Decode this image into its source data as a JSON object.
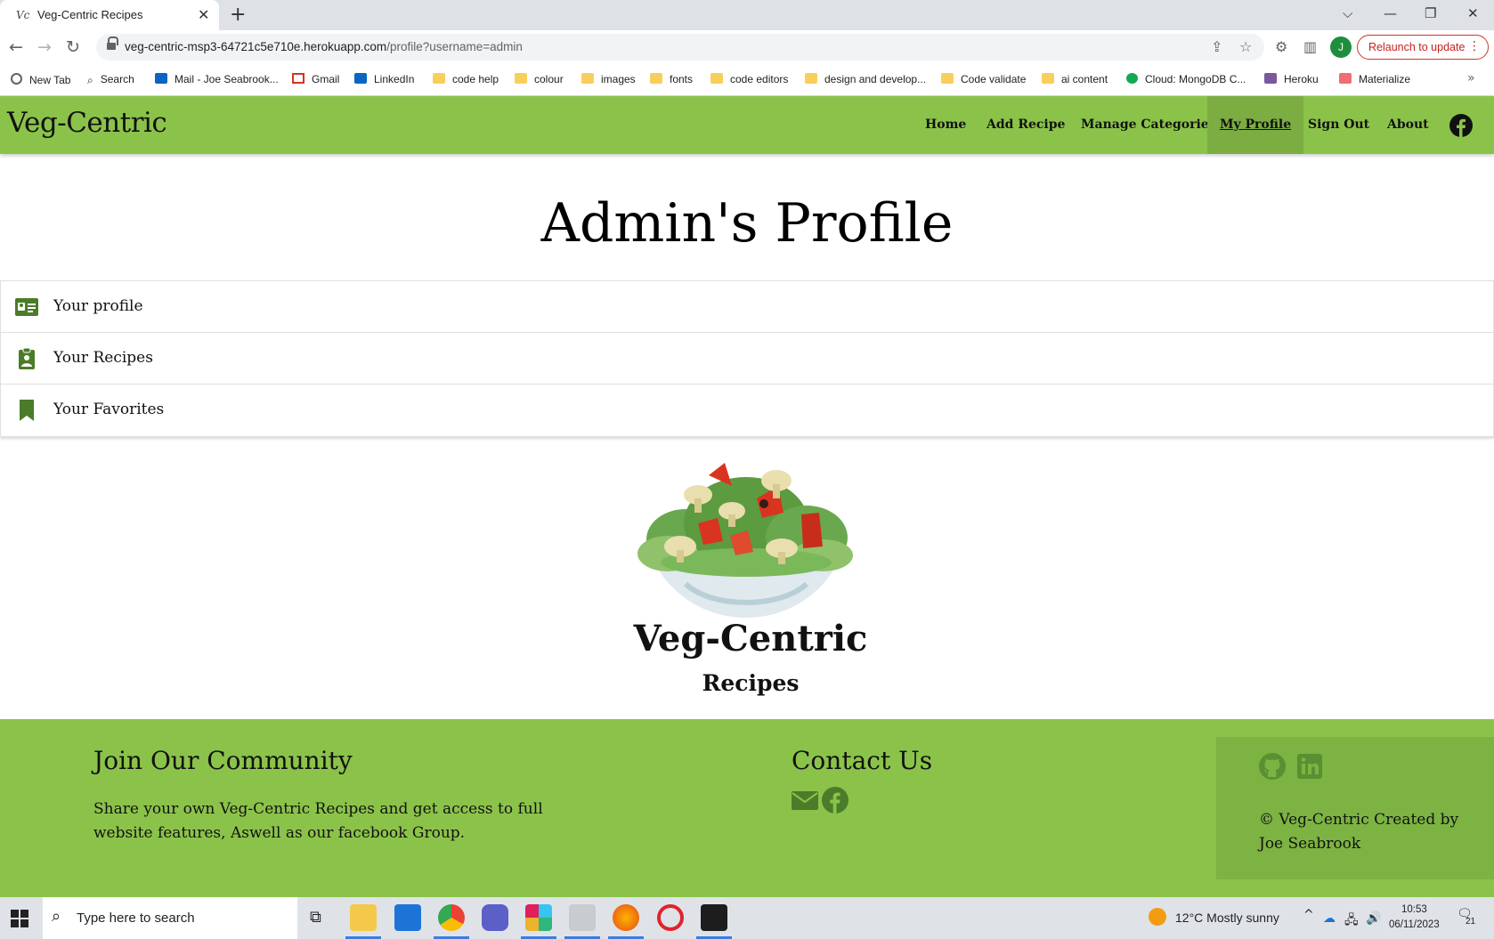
{
  "browser": {
    "tab_title": "Veg-Centric Recipes",
    "tab_favicon": "Vc",
    "new_tab_symbol": "+",
    "url_host": "veg-centric-msp3-64721c5e710e.herokuapp.com",
    "url_path": "/profile?username=admin",
    "avatar_letter": "J",
    "relaunch_label": "Relaunch to update",
    "bookmarks": [
      {
        "label": "New Tab",
        "icon": "globe-icon"
      },
      {
        "label": "Search",
        "icon": "search-icon"
      },
      {
        "label": "Mail - Joe Seabrook...",
        "icon": "outlook-icon"
      },
      {
        "label": "Gmail",
        "icon": "gmail-icon"
      },
      {
        "label": "LinkedIn",
        "icon": "linkedin-icon"
      },
      {
        "label": "code help",
        "icon": "folder-icon"
      },
      {
        "label": "colour",
        "icon": "folder-icon"
      },
      {
        "label": "images",
        "icon": "folder-icon"
      },
      {
        "label": "fonts",
        "icon": "folder-icon"
      },
      {
        "label": "code editors",
        "icon": "folder-icon"
      },
      {
        "label": "design and develop...",
        "icon": "folder-icon"
      },
      {
        "label": "Code validate",
        "icon": "folder-icon"
      },
      {
        "label": "ai content",
        "icon": "folder-icon"
      },
      {
        "label": "Cloud: MongoDB C...",
        "icon": "mongodb-icon"
      },
      {
        "label": "Heroku",
        "icon": "heroku-icon"
      },
      {
        "label": "Materialize",
        "icon": "materialize-icon"
      }
    ]
  },
  "site": {
    "brand": "Veg-Centric",
    "nav": [
      "Home",
      "Add Recipe",
      "Manage Categories",
      "My Profile",
      "Sign Out",
      "About"
    ],
    "active_nav": "My Profile",
    "accent_color": "#8bc34a",
    "accent_dark": "#7cb342",
    "icon_green": "#4a7c2a"
  },
  "main": {
    "title": "Admin's Profile",
    "items": [
      {
        "label": "Your profile",
        "icon": "id-card-icon"
      },
      {
        "label": "Your Recipes",
        "icon": "clipboard-user-icon"
      },
      {
        "label": "Your Favorites",
        "icon": "bookmark-icon"
      }
    ],
    "logo_title": "Veg-Centric",
    "logo_subtitle": "Recipes"
  },
  "footer": {
    "join_heading": "Join Our Community",
    "join_text": "Share your own Veg-Centric Recipes and get access to full website features, Aswell as our facebook Group.",
    "contact_heading": "Contact Us",
    "copyright": "© Veg-Centric Created by Joe Seabrook"
  },
  "taskbar": {
    "search_placeholder": "Type here to search",
    "weather": "12°C  Mostly sunny",
    "time": "10:53",
    "date": "06/11/2023",
    "notifications": "21"
  }
}
